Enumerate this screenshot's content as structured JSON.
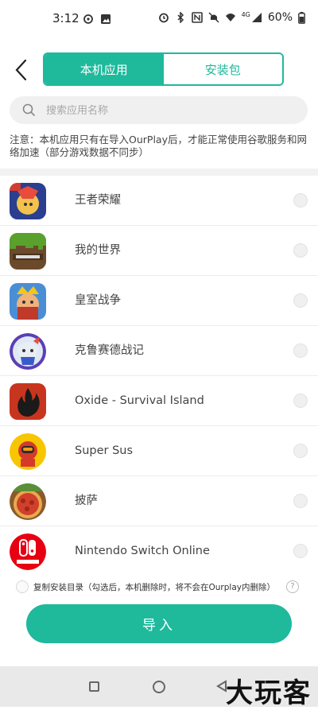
{
  "status_bar": {
    "time": "3:12",
    "battery": "60%",
    "network": "4G"
  },
  "header": {
    "tabs": [
      {
        "label": "本机应用",
        "active": true
      },
      {
        "label": "安装包",
        "active": false
      }
    ]
  },
  "search": {
    "placeholder": "搜索应用名称"
  },
  "notice": "注意：本机应用只有在导入OurPlay后，才能正常使用谷歌服务和网络加速（部分游戏数据不同步）",
  "apps": [
    {
      "name": "王者荣耀",
      "icon": "honor-of-kings-icon"
    },
    {
      "name": "我的世界",
      "icon": "minecraft-icon"
    },
    {
      "name": "皇室战争",
      "icon": "clash-royale-icon"
    },
    {
      "name": "克鲁赛德战记",
      "icon": "crusaders-quest-icon"
    },
    {
      "name": "Oxide - Survival Island",
      "icon": "oxide-icon"
    },
    {
      "name": "Super Sus",
      "icon": "super-sus-icon"
    },
    {
      "name": "披萨",
      "icon": "pizza-icon"
    },
    {
      "name": "Nintendo Switch Online",
      "icon": "nintendo-switch-online-icon"
    }
  ],
  "copy_option": {
    "label": "复制安装目录（勾选后，本机删除时，将不会在Ourplay内删除）"
  },
  "import_button": {
    "label": "导入"
  },
  "watermark": "大玩客",
  "colors": {
    "accent": "#1fb99c"
  }
}
